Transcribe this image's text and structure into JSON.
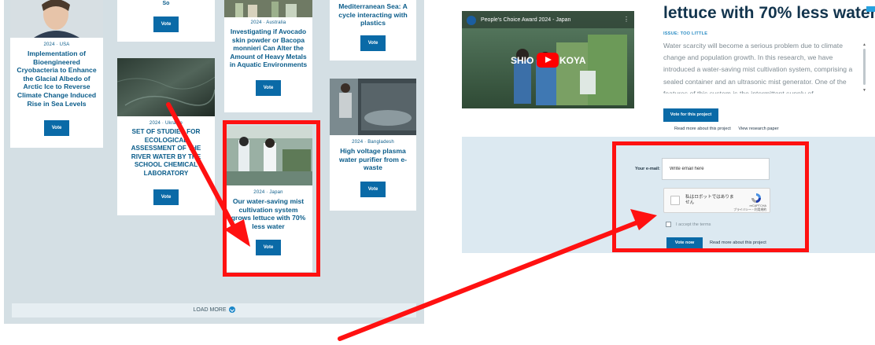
{
  "left_panel": {
    "cards": [
      {
        "meta": "2024 · USA",
        "title": "Implementation of Bioengineered Cryobacteria to Enhance the Glacial Albedo of Arctic Ice to Reverse Climate Change Induced Rise in Sea Levels",
        "vote_label": "Vote"
      },
      {
        "meta": "",
        "title": "So",
        "vote_label": "Vote"
      },
      {
        "meta": "2024 · Ukraine",
        "title": "SET OF STUDIES FOR ECOLOGICAL ASSESSMENT OF THE RIVER WATER BY THE SCHOOL CHEMICAL LABORATORY",
        "vote_label": "Vote"
      },
      {
        "meta": "2024 · Australia",
        "title": "Investigating if Avocado skin powder or Bacopa monnieri Can Alter the Amount of Heavy Metals in Aquatic Environments",
        "vote_label": "Vote"
      },
      {
        "meta": "2024 · Japan",
        "title": "Our water-saving mist cultivation system grows lettuce with 70% less water",
        "vote_label": "Vote"
      },
      {
        "meta": "",
        "title": "Mediterranean Sea: A cycle interacting with plastics",
        "vote_label": "Vote"
      },
      {
        "meta": "2024 · Bangladesh",
        "title": "High voltage plasma water purifier from e-waste",
        "vote_label": "Vote"
      }
    ],
    "load_more": "LOAD MORE"
  },
  "right_panel": {
    "video_title": "People's Choice Award 2024 - Japan",
    "video_overlay_left": "SHIO",
    "video_overlay_right": "KOYA",
    "page_title": "lettuce with 70% less water",
    "issue": "ISSUE: TOO LITTLE",
    "description": "Water scarcity will become a serious problem due to climate change and population growth. In this research, we have introduced a water-saving mist cultivation system, comprising a sealed container and an ultrasonic mist generator. One of the features of this system is the intermittent supply of",
    "vote_project_label": "Vote for this project",
    "read_more_link": "Read more about this project",
    "research_paper_link": "View research paper",
    "form": {
      "email_label": "Your e-mail:",
      "email_value": "Write email here",
      "captcha_label": "私はロボットではありません",
      "captcha_brand": "reCAPTCHA",
      "captcha_terms": "プライバシー・利用規約",
      "terms_label": "I accept the terms",
      "vote_now_label": "Vote now",
      "read_more_label": "Read more about this project"
    }
  },
  "colors": {
    "highlight": "#ff1111",
    "button_blue": "#0a6aa7",
    "title_navy": "#12344d",
    "link_blue": "#0a5c8a"
  }
}
